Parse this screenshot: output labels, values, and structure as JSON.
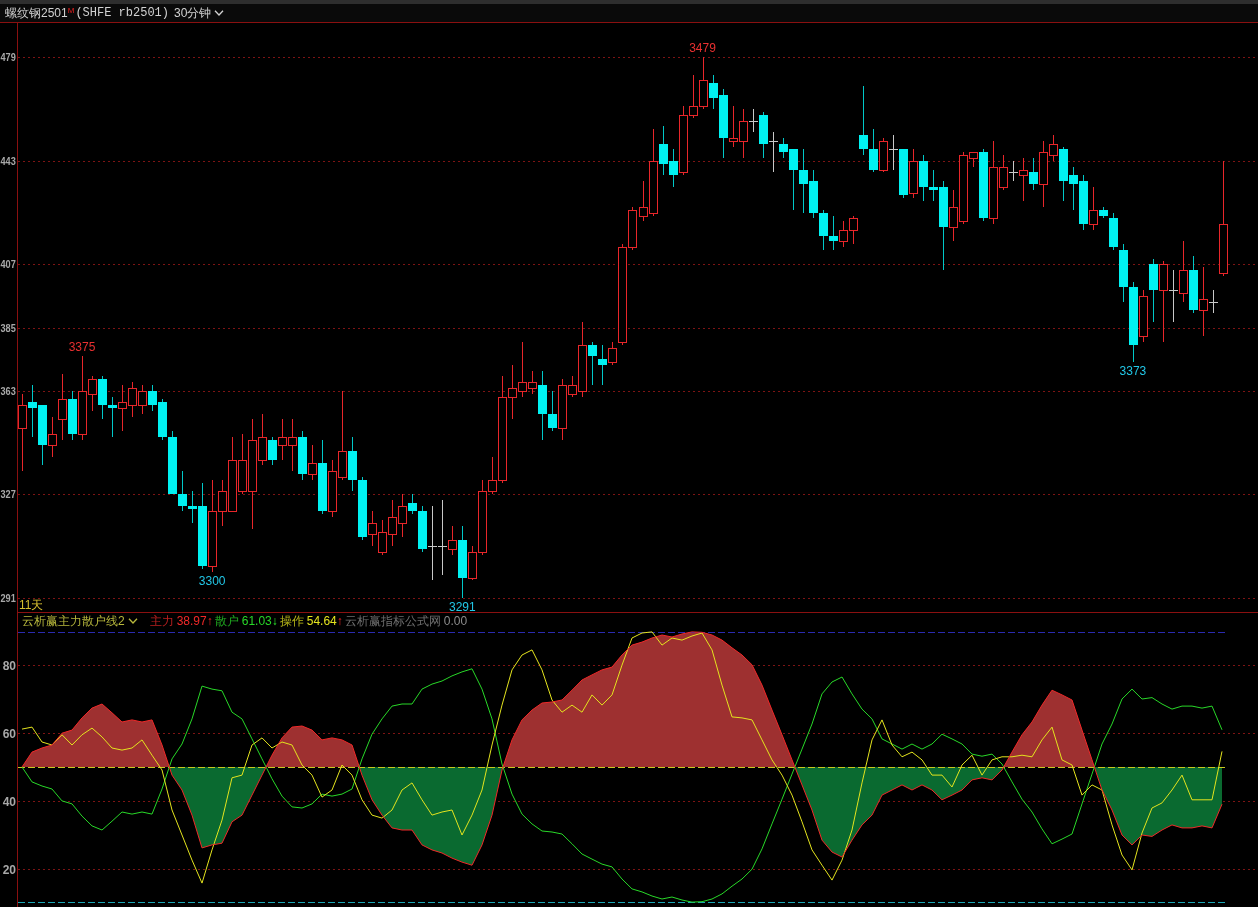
{
  "header": {
    "symbol": "螺纹钢2501",
    "mark": "M",
    "code": "(SHFE rb2501)",
    "period": "30分钟"
  },
  "price_chart": {
    "range_label": "11天",
    "chart_data": {
      "type": "candlestick",
      "ylim": [
        286,
        491
      ],
      "yticks": [
        479,
        443,
        407,
        385,
        363,
        327,
        291
      ],
      "grid": true,
      "categories": [
        null,
        null,
        null,
        null,
        null,
        null,
        null,
        null,
        null,
        null,
        null,
        null,
        null,
        null,
        null,
        null,
        null,
        null,
        null,
        null,
        null,
        null,
        null,
        null,
        null,
        null,
        null,
        null,
        null,
        null,
        null,
        null,
        null,
        null,
        null,
        null,
        null,
        null,
        null,
        null,
        null,
        null,
        null,
        null,
        null,
        null,
        null,
        null,
        null,
        null,
        null,
        null,
        null,
        null,
        null,
        null,
        null,
        null,
        null,
        null,
        null,
        null,
        null,
        null,
        null,
        null,
        null,
        null,
        null,
        null,
        null,
        null,
        null,
        null,
        null,
        null,
        null,
        null,
        null,
        null,
        null,
        null,
        null,
        null,
        null,
        null,
        null,
        null,
        null,
        null,
        null,
        null,
        null,
        null,
        null,
        null,
        null,
        null,
        null,
        null,
        null,
        null,
        null,
        null,
        null,
        null,
        null,
        null,
        null,
        null,
        null,
        null,
        null,
        null,
        null,
        null,
        null,
        null,
        null,
        null,
        null,
        null,
        null,
        null
      ],
      "ohlc": [
        [
          350,
          362,
          335,
          358
        ],
        [
          359,
          365,
          347,
          357
        ],
        [
          358,
          358,
          337,
          344
        ],
        [
          344,
          354,
          340,
          348
        ],
        [
          353,
          369,
          346,
          360
        ],
        [
          360,
          363,
          346,
          348
        ],
        [
          348,
          375,
          346,
          363
        ],
        [
          362,
          368,
          356,
          367
        ],
        [
          367,
          368,
          353,
          358
        ],
        [
          358,
          361,
          347,
          357
        ],
        [
          357,
          365,
          349,
          359
        ],
        [
          358,
          366,
          354,
          364
        ],
        [
          358,
          365,
          355,
          363
        ],
        [
          363,
          365,
          356,
          358
        ],
        [
          359,
          360,
          346,
          347
        ],
        [
          347,
          349,
          327,
          327
        ],
        [
          327,
          335,
          321,
          323
        ],
        [
          323,
          328,
          317,
          322
        ],
        [
          323,
          331,
          301,
          302
        ],
        [
          302,
          332,
          300,
          321
        ],
        [
          321,
          332,
          316,
          328
        ],
        [
          321,
          347,
          321,
          339
        ],
        [
          328,
          348,
          327,
          339
        ],
        [
          328,
          353,
          315,
          346
        ],
        [
          339,
          355,
          337,
          347
        ],
        [
          346,
          347,
          337,
          339
        ],
        [
          344,
          353,
          339,
          347
        ],
        [
          344,
          353,
          335,
          347
        ],
        [
          347,
          349,
          332,
          334
        ],
        [
          334,
          344,
          332,
          338
        ],
        [
          338,
          346,
          320,
          321
        ],
        [
          321,
          339,
          319,
          335
        ],
        [
          333,
          363,
          332,
          342
        ],
        [
          342,
          347,
          328,
          332
        ],
        [
          332,
          333,
          311,
          312
        ],
        [
          313,
          321,
          309,
          317
        ],
        [
          307,
          318,
          306,
          314
        ],
        [
          313,
          325,
          309,
          319
        ],
        [
          317,
          327,
          312,
          323
        ],
        [
          324,
          327,
          320,
          321
        ],
        [
          321,
          323,
          307,
          308
        ],
        [
          309,
          323,
          297,
          309
        ],
        [
          309,
          325,
          299,
          309
        ],
        [
          308,
          316,
          306,
          311
        ],
        [
          311,
          316,
          291,
          298
        ],
        [
          298,
          309,
          297,
          307
        ],
        [
          307,
          332,
          306,
          328
        ],
        [
          328,
          340,
          327,
          332
        ],
        [
          332,
          368,
          331,
          361
        ],
        [
          361,
          372,
          353,
          364
        ],
        [
          363,
          380,
          361,
          366
        ],
        [
          364,
          370,
          362,
          366
        ],
        [
          365,
          370,
          346,
          355
        ],
        [
          355,
          363,
          349,
          350
        ],
        [
          350,
          367,
          346,
          365
        ],
        [
          362,
          368,
          361,
          365
        ],
        [
          363,
          387,
          361,
          379
        ],
        [
          379,
          380,
          365,
          375
        ],
        [
          374,
          379,
          365,
          372
        ],
        [
          373,
          380,
          372,
          378
        ],
        [
          380,
          414,
          379,
          413
        ],
        [
          413,
          427,
          412,
          426
        ],
        [
          424,
          436,
          422,
          427
        ],
        [
          425,
          454,
          424,
          443
        ],
        [
          449,
          455,
          438,
          442
        ],
        [
          443,
          447,
          434,
          438
        ],
        [
          439,
          462,
          438,
          459
        ],
        [
          459,
          473,
          458,
          462
        ],
        [
          462,
          479,
          461,
          471
        ],
        [
          470,
          473,
          461,
          465
        ],
        [
          466,
          468,
          444,
          451
        ],
        [
          450,
          462,
          448,
          451
        ],
        [
          450,
          461,
          444,
          457
        ],
        [
          457,
          461,
          453,
          457
        ],
        [
          459,
          460,
          444,
          449
        ],
        [
          450,
          453,
          439,
          450
        ],
        [
          449,
          451,
          444,
          446
        ],
        [
          447,
          447,
          426,
          440
        ],
        [
          440,
          447,
          425,
          435
        ],
        [
          436,
          440,
          423,
          425
        ],
        [
          425,
          426,
          412,
          417
        ],
        [
          417,
          424,
          412,
          415
        ],
        [
          415,
          422,
          413,
          419
        ],
        [
          419,
          424,
          414,
          423
        ],
        [
          452,
          469,
          445,
          447
        ],
        [
          447,
          454,
          439,
          440
        ],
        [
          440,
          451,
          439,
          450
        ],
        [
          447,
          452,
          440,
          447
        ],
        [
          447,
          447,
          430,
          431
        ],
        [
          432,
          447,
          430,
          443
        ],
        [
          443,
          445,
          429,
          434
        ],
        [
          434,
          440,
          429,
          433
        ],
        [
          434,
          436,
          405,
          420
        ],
        [
          420,
          433,
          415,
          427
        ],
        [
          422,
          446,
          421,
          445
        ],
        [
          444,
          446,
          441,
          446
        ],
        [
          446,
          447,
          422,
          423
        ],
        [
          423,
          450,
          421,
          441
        ],
        [
          434,
          445,
          433,
          441
        ],
        [
          439,
          443,
          436,
          439
        ],
        [
          438,
          444,
          429,
          440
        ],
        [
          439,
          444,
          433,
          435
        ],
        [
          435,
          450,
          427,
          446
        ],
        [
          445,
          452,
          443,
          449
        ],
        [
          447,
          448,
          429,
          436
        ],
        [
          438,
          441,
          426,
          435
        ],
        [
          436,
          438,
          419,
          421
        ],
        [
          421,
          434,
          419,
          426
        ],
        [
          426,
          427,
          423,
          424
        ],
        [
          423,
          425,
          412,
          413
        ],
        [
          412,
          414,
          394,
          399
        ],
        [
          399,
          401,
          373,
          379
        ],
        [
          382,
          398,
          380,
          396
        ],
        [
          407,
          409,
          387,
          398
        ],
        [
          398,
          408,
          380,
          407
        ],
        [
          398,
          405,
          387,
          398
        ],
        [
          397,
          415,
          394,
          405
        ],
        [
          405,
          410,
          390,
          391
        ],
        [
          391,
          406,
          382,
          395
        ],
        [
          394,
          398,
          390,
          394
        ],
        [
          404,
          443,
          403,
          421
        ],
        null,
        null,
        null
      ],
      "annotations": [
        "3375",
        "3300",
        "3291",
        "3479",
        "3373"
      ]
    }
  },
  "indicator": {
    "name": "云析赢主力散户线2",
    "legend": [
      {
        "value": "38.97",
        "arrow": "↑",
        "kind": "up"
      },
      {
        "value": "61.03",
        "arrow": "↓",
        "kind": "down"
      },
      {
        "value": "54.64",
        "arrow": "↑",
        "kind": "up"
      },
      {
        "name": "云析赢指标公式网",
        "value": "0.00",
        "color": "#8c8c8c"
      }
    ],
    "chart_data": {
      "type": "line",
      "ylim": [
        10,
        90
      ],
      "yticks": [
        20,
        40,
        60,
        80
      ],
      "grid": true,
      "ref_lines": [
        {
          "axis": "y",
          "value": 90,
          "color": "#2a2ab0"
        },
        {
          "axis": "y",
          "value": 50,
          "color": "#c8c820"
        },
        {
          "axis": "y",
          "value": 10,
          "color": "#18a8b8"
        }
      ],
      "series": [
        {
          "name": "主力",
          "color": "#f02828",
          "values": [
            50.0,
            54.4,
            55.6,
            56.5,
            60.0,
            60.9,
            64.5,
            67.4,
            68.6,
            66.0,
            63.3,
            63.9,
            63.3,
            63.9,
            56.5,
            47.6,
            43.2,
            35.8,
            26.1,
            27.0,
            27.5,
            33.8,
            35.8,
            41.7,
            47.6,
            53.5,
            58.6,
            61.8,
            62.1,
            60.9,
            58.0,
            58.6,
            58.0,
            56.5,
            47.6,
            40.3,
            35.8,
            32.0,
            31.4,
            31.4,
            27.0,
            25.5,
            24.6,
            23.1,
            21.9,
            21.0,
            27.0,
            35.8,
            49.1,
            58.0,
            63.9,
            66.8,
            68.9,
            69.2,
            69.8,
            72.7,
            75.7,
            77.2,
            78.7,
            79.5,
            83.1,
            86.0,
            86.9,
            88.1,
            89.0,
            88.4,
            89.3,
            89.9,
            89.8,
            89.0,
            87.5,
            85.2,
            83.1,
            80.2,
            74.2,
            66.8,
            59.5,
            52.1,
            44.7,
            37.3,
            28.4,
            24.9,
            23.4,
            28.4,
            32.9,
            35.8,
            41.7,
            43.2,
            44.7,
            43.2,
            44.7,
            43.2,
            40.3,
            41.7,
            43.2,
            46.2,
            46.8,
            46.2,
            49.1,
            54.4,
            59.5,
            63.3,
            68.3,
            72.7,
            71.3,
            69.8,
            60.9,
            52.1,
            43.2,
            37.3,
            29.9,
            27.0,
            29.9,
            29.5,
            31.4,
            32.9,
            32.0,
            32.0,
            32.6,
            32.0,
            39.0
          ]
        },
        {
          "name": "散户",
          "color": "#28d828",
          "values": [
            50.0,
            45.6,
            44.4,
            43.5,
            40.0,
            39.1,
            35.5,
            32.6,
            31.4,
            34.0,
            36.7,
            36.1,
            36.7,
            36.1,
            43.5,
            52.4,
            56.8,
            64.2,
            73.9,
            73.0,
            72.5,
            66.2,
            64.2,
            58.3,
            52.4,
            46.5,
            41.4,
            38.2,
            37.9,
            39.1,
            42.0,
            41.4,
            42.0,
            43.5,
            52.4,
            59.7,
            64.2,
            68.0,
            68.6,
            68.6,
            73.0,
            74.5,
            75.4,
            76.9,
            78.1,
            79.0,
            73.0,
            64.2,
            50.9,
            42.0,
            36.1,
            33.2,
            31.1,
            30.8,
            30.2,
            27.3,
            24.3,
            22.8,
            21.3,
            20.5,
            16.9,
            14.0,
            13.1,
            11.9,
            11.0,
            11.6,
            10.7,
            10.1,
            10.2,
            11.0,
            12.5,
            14.8,
            16.9,
            19.8,
            25.8,
            33.2,
            40.5,
            47.9,
            55.3,
            62.7,
            71.6,
            75.1,
            76.6,
            71.6,
            67.1,
            64.2,
            58.3,
            56.8,
            55.3,
            56.8,
            55.3,
            56.8,
            59.7,
            58.3,
            56.8,
            53.8,
            53.2,
            53.8,
            50.9,
            45.6,
            40.5,
            36.7,
            31.7,
            27.3,
            28.7,
            30.2,
            39.1,
            47.9,
            56.8,
            62.7,
            70.1,
            73.0,
            70.1,
            70.5,
            68.6,
            67.1,
            68.0,
            68.0,
            67.4,
            68.0,
            61.0
          ]
        },
        {
          "name": "操作",
          "color": "#e4e41e",
          "values": [
            61.2,
            61.8,
            57.4,
            56.5,
            59.5,
            56.5,
            59.5,
            61.5,
            58.9,
            55.6,
            55.0,
            55.6,
            58.0,
            53.5,
            49.1,
            37.3,
            29.9,
            22.5,
            15.7,
            25.5,
            34.3,
            46.8,
            47.6,
            56.5,
            58.6,
            55.6,
            57.4,
            56.5,
            50.6,
            47.6,
            41.1,
            43.2,
            50.6,
            47.6,
            40.3,
            35.8,
            34.9,
            37.3,
            43.2,
            45.3,
            40.3,
            35.8,
            36.7,
            37.3,
            29.9,
            35.8,
            43.2,
            56.5,
            68.3,
            78.7,
            83.1,
            84.6,
            78.7,
            69.8,
            66.2,
            68.3,
            66.2,
            71.3,
            68.3,
            71.3,
            80.1,
            88.1,
            89.6,
            89.9,
            86.0,
            88.1,
            87.5,
            88.7,
            89.6,
            84.6,
            74.2,
            64.8,
            64.5,
            63.9,
            58.0,
            52.1,
            47.6,
            41.7,
            33.8,
            25.5,
            21.0,
            16.6,
            22.5,
            31.4,
            45.3,
            58.0,
            63.9,
            56.5,
            53.0,
            54.4,
            52.1,
            47.6,
            47.6,
            44.1,
            50.6,
            53.5,
            47.6,
            52.1,
            53.0,
            53.0,
            53.5,
            53.0,
            58.0,
            61.8,
            52.1,
            50.6,
            41.7,
            44.7,
            43.2,
            32.9,
            24.0,
            19.6,
            30.5,
            37.9,
            39.4,
            43.2,
            47.6,
            40.3,
            40.3,
            40.3,
            54.6
          ]
        }
      ]
    }
  }
}
